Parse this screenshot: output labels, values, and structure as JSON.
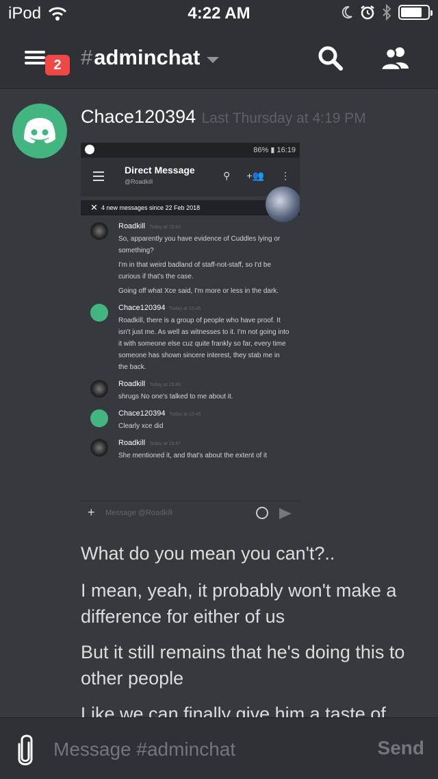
{
  "status_bar": {
    "carrier": "iPod",
    "time": "4:22 AM"
  },
  "header": {
    "badge_count": "2",
    "channel_hash": "#",
    "channel_name": "adminchat"
  },
  "message": {
    "author": "Chace120394",
    "timestamp": "Last Thursday at 4:19 PM",
    "attachment": {
      "status_battery": "86%",
      "status_time": "16:19",
      "title": "Direct Message",
      "subtitle": "@Roadkill",
      "new_messages_bar": "4 new messages since 22 Feb 2018",
      "messages": [
        {
          "author": "Roadkill",
          "time": "Today at 15:43",
          "avatar": "dark",
          "lines": [
            "So, apparently you have evidence of Cuddles lying or something?",
            "I'm in that weird badland of staff-not-staff, so I'd be curious if that's the case.",
            "Going off what Xce said, I'm more or less in the dark."
          ]
        },
        {
          "author": "Chace120394",
          "time": "Today at 15:45",
          "avatar": "green",
          "lines": [
            "Roadkill, there is a group of people who have proof. It isn't just me. As well as witnesses to it. I'm not going into it with someone else cuz quite frankly so far, every time someone has shown sincere interest, they stab me in the back."
          ]
        },
        {
          "author": "Roadkill",
          "time": "Today at 15:46",
          "avatar": "dark",
          "lines": [
            "shrugs No one's talked to me about it."
          ]
        },
        {
          "author": "Chace120394",
          "time": "Today at 15:46",
          "avatar": "green",
          "lines": [
            "Clearly xce did"
          ]
        },
        {
          "author": "Roadkill",
          "time": "Today at 15:47",
          "avatar": "dark",
          "lines": [
            "She mentioned it, and that's about the extent of it"
          ]
        }
      ],
      "input_placeholder": "Message @Roadkill"
    },
    "lines": [
      "What do you mean you can't?..",
      "I mean, yeah, it probably won't make a difference for either of us",
      "But it still remains that he's doing this to other people",
      "Like we can finally give him a taste of"
    ]
  },
  "composer": {
    "placeholder": "Message #adminchat",
    "send_label": "Send"
  },
  "colors": {
    "background": "#36393e",
    "header": "#2f3136",
    "badge": "#f04747",
    "avatar_green": "#43b581"
  },
  "icons": [
    "wifi-icon",
    "moon-icon",
    "alarm-icon",
    "bluetooth-icon",
    "battery-icon",
    "menu-icon",
    "search-icon",
    "members-icon",
    "discord-logo-icon",
    "paperclip-icon"
  ]
}
